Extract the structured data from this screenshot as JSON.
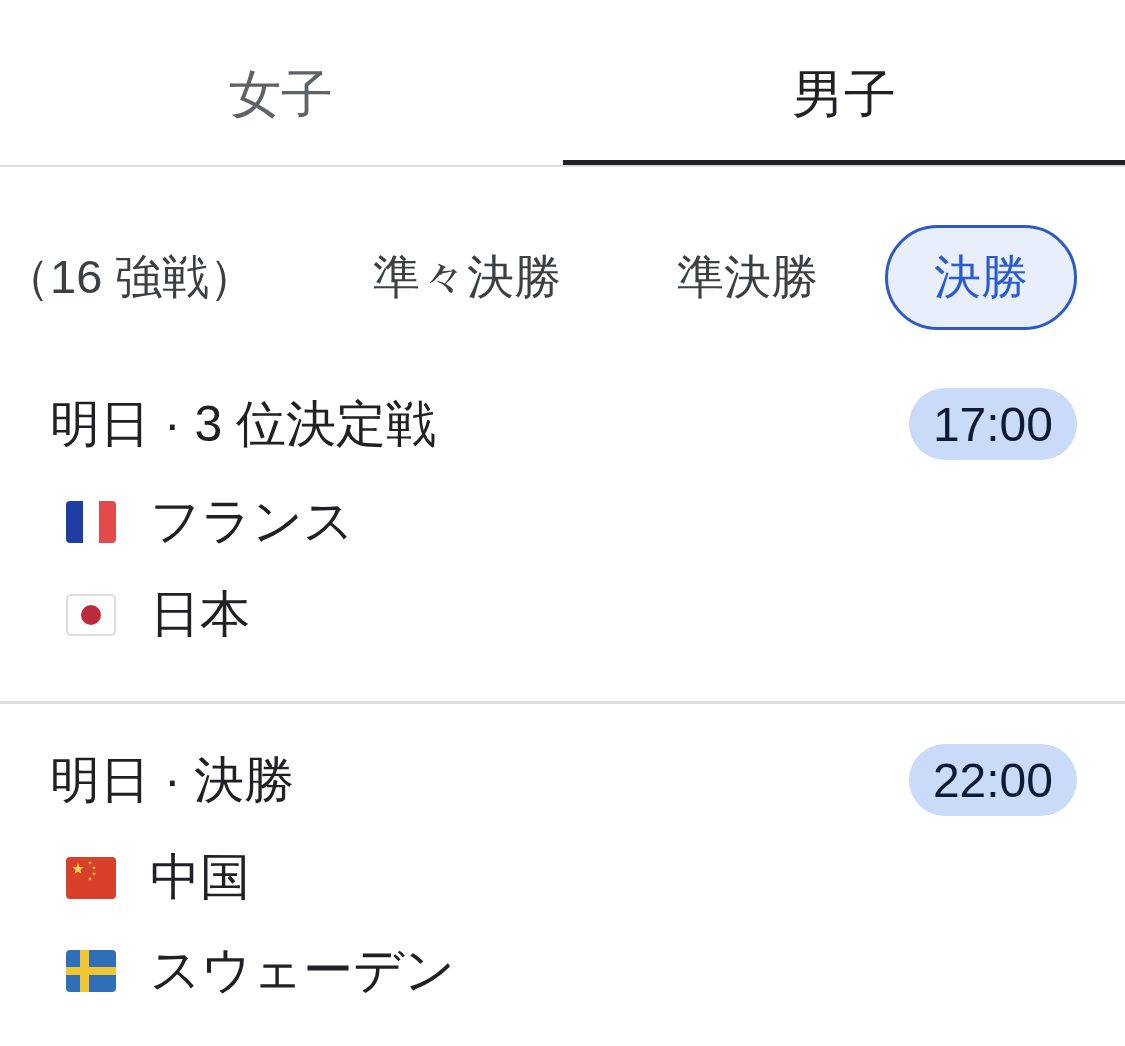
{
  "tabs": [
    {
      "label": "女子",
      "selected": false
    },
    {
      "label": "男子",
      "selected": true
    }
  ],
  "stages": [
    {
      "label": "（16 強戦）",
      "selected": false
    },
    {
      "label": "準々決勝",
      "selected": false
    },
    {
      "label": "準決勝",
      "selected": false
    },
    {
      "label": "決勝",
      "selected": true
    }
  ],
  "matches": [
    {
      "title": "明日 · 3 位決定戦",
      "time": "17:00",
      "teams": [
        {
          "name": "フランス",
          "kind": "france"
        },
        {
          "name": "日本",
          "kind": "japan"
        }
      ]
    },
    {
      "title": "明日 · 決勝",
      "time": "22:00",
      "teams": [
        {
          "name": "中国",
          "kind": "china"
        },
        {
          "name": "スウェーデン",
          "kind": "sweden"
        }
      ]
    }
  ]
}
